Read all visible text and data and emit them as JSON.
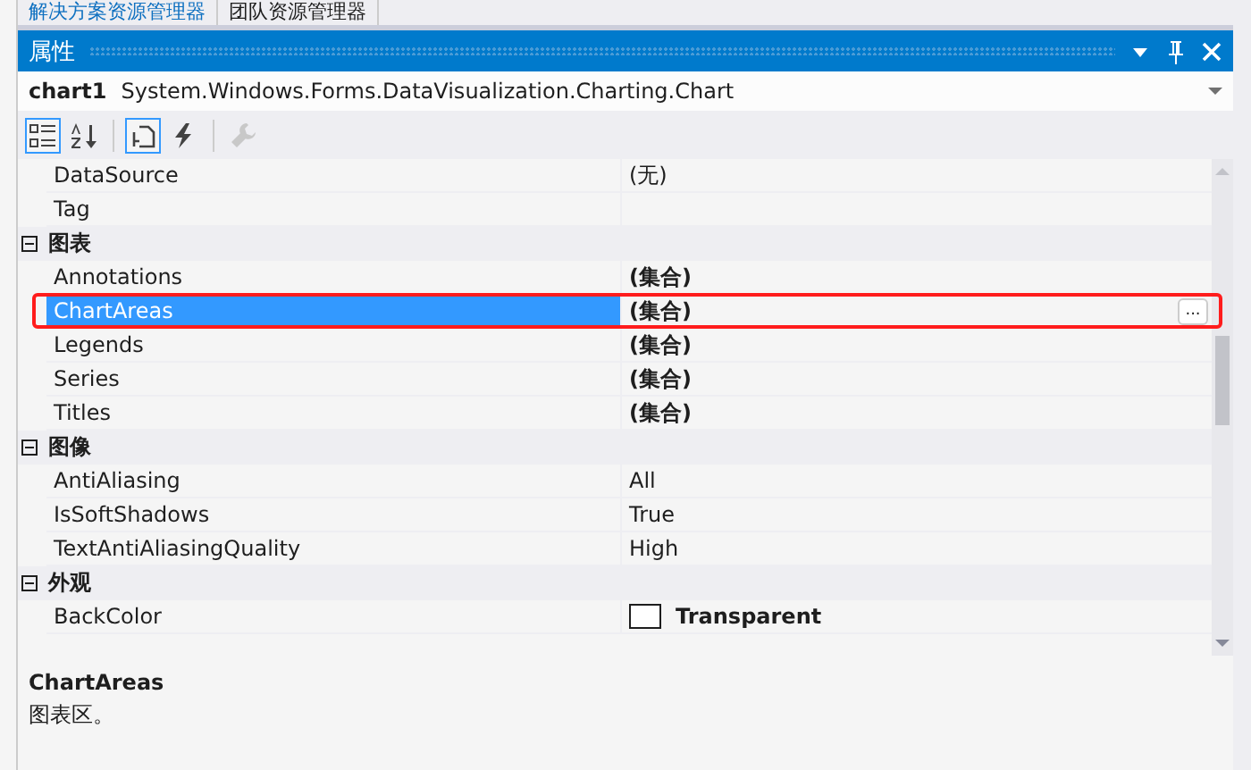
{
  "doc_tabs": [
    {
      "label": "解决方案资源管理器",
      "selected": true
    },
    {
      "label": "团队资源管理器",
      "selected": false
    }
  ],
  "panel": {
    "title": "属性"
  },
  "object_selector": {
    "name": "chart1",
    "type": "System.Windows.Forms.DataVisualization.Charting.Chart"
  },
  "toolbar": [
    {
      "kind": "categorized",
      "selected": true,
      "disabled": false
    },
    {
      "kind": "alphabetical",
      "selected": false,
      "disabled": false
    },
    {
      "kind": "separator"
    },
    {
      "kind": "properties",
      "selected": true,
      "disabled": false
    },
    {
      "kind": "events",
      "selected": false,
      "disabled": false
    },
    {
      "kind": "separator"
    },
    {
      "kind": "pages",
      "selected": false,
      "disabled": true
    }
  ],
  "rows": [
    {
      "kind": "property",
      "name": "DataSource",
      "value": "(无)",
      "modified": false,
      "selected": false
    },
    {
      "kind": "property",
      "name": "Tag",
      "selected": false
    },
    {
      "kind": "category",
      "label": "图表",
      "expanded": true
    },
    {
      "kind": "property",
      "name": "Annotations",
      "value": "(集合)",
      "modified": true,
      "selected": false
    },
    {
      "kind": "property",
      "name": "ChartAreas",
      "value": "(集合)",
      "modified": true,
      "selected": true,
      "ellipsis": "..."
    },
    {
      "kind": "property",
      "name": "Legends",
      "value": "(集合)",
      "modified": true,
      "selected": false
    },
    {
      "kind": "property",
      "name": "Series",
      "value": "(集合)",
      "modified": true,
      "selected": false
    },
    {
      "kind": "property",
      "name": "Titles",
      "value": "(集合)",
      "modified": true,
      "selected": false
    },
    {
      "kind": "category",
      "label": "图像",
      "expanded": true
    },
    {
      "kind": "property",
      "name": "AntiAliasing",
      "value": "All",
      "modified": false,
      "selected": false
    },
    {
      "kind": "property",
      "name": "IsSoftShadows",
      "value": "True",
      "modified": false,
      "selected": false
    },
    {
      "kind": "property",
      "name": "TextAntiAliasingQuality",
      "value": "High",
      "modified": false,
      "selected": false
    },
    {
      "kind": "category",
      "label": "外观",
      "expanded": true
    },
    {
      "kind": "property",
      "name": "BackColor",
      "value": "Transparent",
      "modified": true,
      "selected": false,
      "swatch": true
    }
  ],
  "description": {
    "title": "ChartAreas",
    "text": "图表区。"
  }
}
